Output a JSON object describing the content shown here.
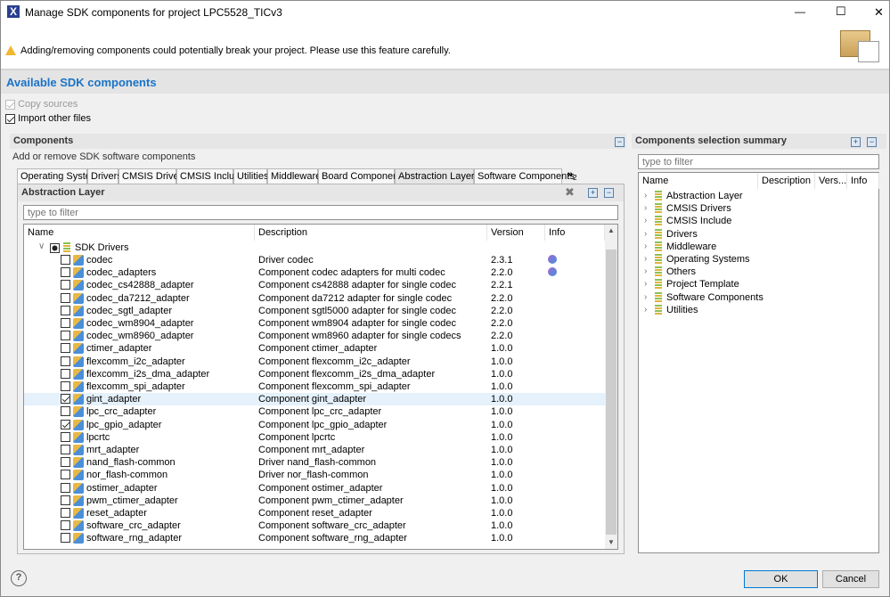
{
  "window": {
    "title": "Manage SDK components for project LPC5528_TICv3",
    "minimize": "—",
    "maximize": "☐",
    "close": "✕"
  },
  "warning": "Adding/removing components could potentially break your project. Please use this feature carefully.",
  "heading": "Available SDK components",
  "options": [
    {
      "label": "Copy sources",
      "checked": true,
      "disabled": true
    },
    {
      "label": "Import other files",
      "checked": true,
      "disabled": false
    }
  ],
  "components": {
    "title": "Components",
    "subtitle": "Add or remove SDK software components",
    "tabs": [
      "Operating Systems",
      "Drivers",
      "CMSIS Drivers",
      "CMSIS Include",
      "Utilities",
      "Middleware",
      "Board Components",
      "Abstraction Layer",
      "Software Components"
    ],
    "active_tab": "Abstraction Layer",
    "overflow": "»",
    "overflow_count": "2",
    "panel_title": "Abstraction Layer",
    "filter_placeholder": "type to filter",
    "columns": [
      "Name",
      "Description",
      "Version",
      "Info"
    ],
    "group": "SDK Drivers",
    "rows": [
      {
        "name": "codec",
        "desc": "Driver codec",
        "ver": "2.3.1",
        "checked": false,
        "info": true
      },
      {
        "name": "codec_adapters",
        "desc": "Component codec adapters for multi codec",
        "ver": "2.2.0",
        "checked": false,
        "info": true
      },
      {
        "name": "codec_cs42888_adapter",
        "desc": "Component cs42888 adapter for single codec",
        "ver": "2.2.1",
        "checked": false
      },
      {
        "name": "codec_da7212_adapter",
        "desc": "Component da7212 adapter for single codec",
        "ver": "2.2.0",
        "checked": false
      },
      {
        "name": "codec_sgtl_adapter",
        "desc": "Component sgtl5000 adapter for single codec",
        "ver": "2.2.0",
        "checked": false
      },
      {
        "name": "codec_wm8904_adapter",
        "desc": "Component wm8904 adapter for single codec",
        "ver": "2.2.0",
        "checked": false
      },
      {
        "name": "codec_wm8960_adapter",
        "desc": "Component wm8960 adapter for single codecs",
        "ver": "2.2.0",
        "checked": false
      },
      {
        "name": "ctimer_adapter",
        "desc": "Component ctimer_adapter",
        "ver": "1.0.0",
        "checked": false
      },
      {
        "name": "flexcomm_i2c_adapter",
        "desc": "Component flexcomm_i2c_adapter",
        "ver": "1.0.0",
        "checked": false
      },
      {
        "name": "flexcomm_i2s_dma_adapter",
        "desc": "Component flexcomm_i2s_dma_adapter",
        "ver": "1.0.0",
        "checked": false
      },
      {
        "name": "flexcomm_spi_adapter",
        "desc": "Component flexcomm_spi_adapter",
        "ver": "1.0.0",
        "checked": false
      },
      {
        "name": "gint_adapter",
        "desc": "Component gint_adapter",
        "ver": "1.0.0",
        "checked": true,
        "selected": true
      },
      {
        "name": "lpc_crc_adapter",
        "desc": "Component lpc_crc_adapter",
        "ver": "1.0.0",
        "checked": false
      },
      {
        "name": "lpc_gpio_adapter",
        "desc": "Component lpc_gpio_adapter",
        "ver": "1.0.0",
        "checked": true
      },
      {
        "name": "lpcrtc",
        "desc": "Component lpcrtc",
        "ver": "1.0.0",
        "checked": false
      },
      {
        "name": "mrt_adapter",
        "desc": "Component mrt_adapter",
        "ver": "1.0.0",
        "checked": false
      },
      {
        "name": "nand_flash-common",
        "desc": "Driver nand_flash-common",
        "ver": "1.0.0",
        "checked": false
      },
      {
        "name": "nor_flash-common",
        "desc": "Driver nor_flash-common",
        "ver": "1.0.0",
        "checked": false
      },
      {
        "name": "ostimer_adapter",
        "desc": "Component ostimer_adapter",
        "ver": "1.0.0",
        "checked": false
      },
      {
        "name": "pwm_ctimer_adapter",
        "desc": "Component pwm_ctimer_adapter",
        "ver": "1.0.0",
        "checked": false
      },
      {
        "name": "reset_adapter",
        "desc": "Component reset_adapter",
        "ver": "1.0.0",
        "checked": false
      },
      {
        "name": "software_crc_adapter",
        "desc": "Component software_crc_adapter",
        "ver": "1.0.0",
        "checked": false
      },
      {
        "name": "software_rng_adapter",
        "desc": "Component software_rng_adapter",
        "ver": "1.0.0",
        "checked": false
      }
    ]
  },
  "summary": {
    "title": "Components selection summary",
    "filter_placeholder": "type to filter",
    "columns": [
      "Name",
      "Description",
      "Vers...",
      "Info"
    ],
    "items": [
      "Abstraction Layer",
      "CMSIS Drivers",
      "CMSIS Include",
      "Drivers",
      "Middleware",
      "Operating Systems",
      "Others",
      "Project Template",
      "Software Components",
      "Utilities"
    ]
  },
  "footer": {
    "help": "?",
    "ok": "OK",
    "cancel": "Cancel"
  },
  "colors": {
    "accent": "#1a73c7",
    "selection": "#e5f1fb"
  }
}
